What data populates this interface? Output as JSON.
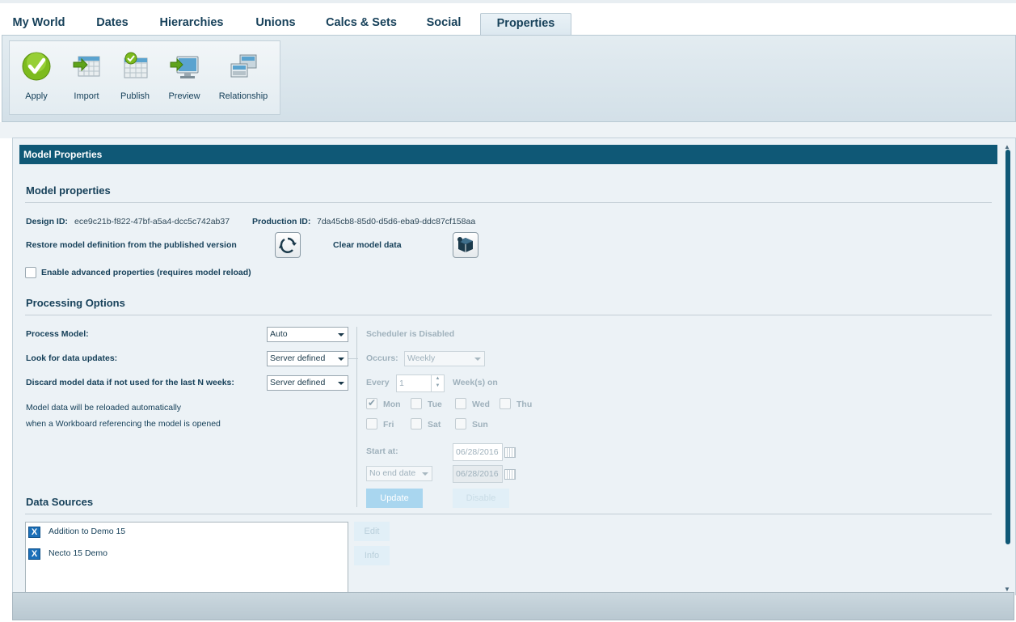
{
  "tabs": [
    {
      "label": "My World"
    },
    {
      "label": "Dates"
    },
    {
      "label": "Hierarchies"
    },
    {
      "label": "Unions"
    },
    {
      "label": "Calcs & Sets"
    },
    {
      "label": "Social"
    },
    {
      "label": "Properties"
    }
  ],
  "ribbon": {
    "apply": "Apply",
    "import": "Import",
    "publish": "Publish",
    "preview": "Preview",
    "relationship": "Relationship"
  },
  "panel": {
    "title": "Model Properties",
    "model_section": "Model properties",
    "design_id_label": "Design ID:",
    "design_id": "ece9c21b-f822-47bf-a5a4-dcc5c742ab37",
    "production_id_label": "Production ID:",
    "production_id": "7da45cb8-85d0-d5d6-eba9-ddc87cf158aa",
    "restore_label": "Restore model definition from the published version",
    "clear_label": "Clear model data",
    "advanced_label": "Enable advanced properties (requires model reload)",
    "processing_section": "Processing Options",
    "process_model_label": "Process Model:",
    "process_model_value": "Auto",
    "look_updates_label": "Look for data updates:",
    "look_updates_value": "Server defined",
    "discard_label": "Discard model data if not used for the last N weeks:",
    "discard_value": "Server defined",
    "reload_note_1": "Model data will be reloaded automatically",
    "reload_note_2": "when a Workboard referencing the model is opened",
    "scheduler": {
      "status": "Scheduler is Disabled",
      "occurs_label": "Occurs:",
      "occurs_value": "Weekly",
      "every_label": "Every",
      "every_value": "1",
      "weeks_on": "Week(s) on",
      "days": [
        {
          "label": "Mon",
          "checked": true
        },
        {
          "label": "Tue",
          "checked": false
        },
        {
          "label": "Wed",
          "checked": false
        },
        {
          "label": "Thu",
          "checked": false
        },
        {
          "label": "Fri",
          "checked": false
        },
        {
          "label": "Sat",
          "checked": false
        },
        {
          "label": "Sun",
          "checked": false
        }
      ],
      "start_label": "Start at:",
      "start_date": "06/28/2016",
      "end_option": "No end date",
      "end_date": "06/28/2016",
      "update_button": "Update",
      "disable_button": "Disable"
    },
    "data_sources_section": "Data Sources",
    "data_sources": [
      {
        "name": "Addition to Demo 15"
      },
      {
        "name": "Necto 15 Demo"
      }
    ],
    "edit_button": "Edit",
    "info_button": "Info"
  }
}
